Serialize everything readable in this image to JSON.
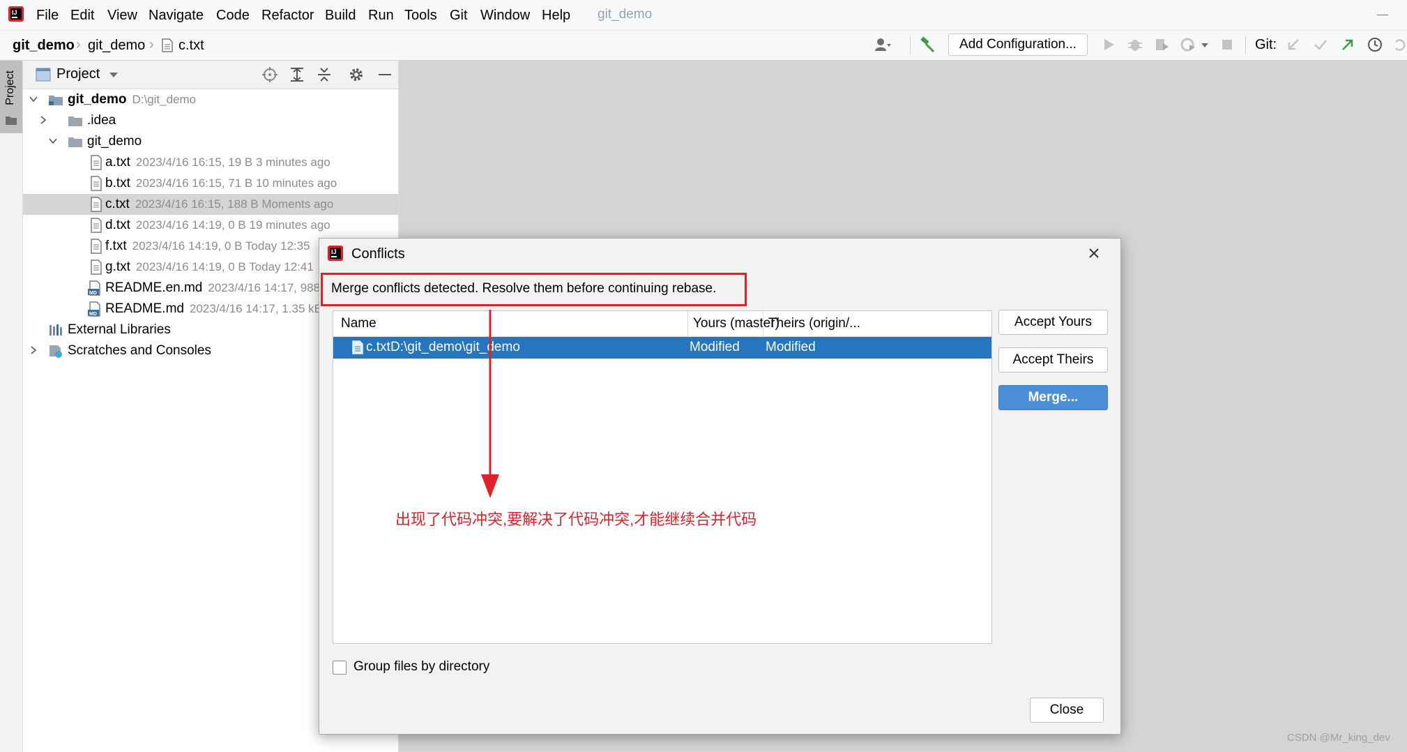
{
  "menu": {
    "items": [
      "File",
      "Edit",
      "View",
      "Navigate",
      "Code",
      "Refactor",
      "Build",
      "Run",
      "Tools",
      "Git",
      "Window",
      "Help"
    ],
    "window_title": "git_demo"
  },
  "breadcrumb": {
    "items": [
      "git_demo",
      "git_demo",
      "c.txt"
    ]
  },
  "toolbar": {
    "add_configuration": "Add Configuration...",
    "git_label": "Git:"
  },
  "stripe": {
    "project_label": "Project"
  },
  "project_panel": {
    "title": "Project",
    "tree": [
      {
        "name": "git_demo",
        "meta": "D:\\git_demo",
        "kind": "folder",
        "expanded": true,
        "bold": true
      },
      {
        "name": ".idea",
        "meta": "",
        "kind": "folder",
        "expanded": false
      },
      {
        "name": "git_demo",
        "meta": "",
        "kind": "folder",
        "expanded": true
      },
      {
        "name": "a.txt",
        "meta": "2023/4/16 16:15, 19 B 3 minutes ago",
        "kind": "file"
      },
      {
        "name": "b.txt",
        "meta": "2023/4/16 16:15, 71 B 10 minutes ago",
        "kind": "file"
      },
      {
        "name": "c.txt",
        "meta": "2023/4/16 16:15, 188 B Moments ago",
        "kind": "file",
        "selected": true
      },
      {
        "name": "d.txt",
        "meta": "2023/4/16 14:19, 0 B 19 minutes ago",
        "kind": "file"
      },
      {
        "name": "f.txt",
        "meta": "2023/4/16 14:19, 0 B Today 12:35",
        "kind": "file"
      },
      {
        "name": "g.txt",
        "meta": "2023/4/16 14:19, 0 B Today 12:41",
        "kind": "file"
      },
      {
        "name": "README.en.md",
        "meta": "2023/4/16 14:17, 988",
        "kind": "md"
      },
      {
        "name": "README.md",
        "meta": "2023/4/16 14:17, 1.35 kB",
        "kind": "md"
      },
      {
        "name": "External Libraries",
        "meta": "",
        "kind": "libs"
      },
      {
        "name": "Scratches and Consoles",
        "meta": "",
        "kind": "scratches",
        "expanded": false
      }
    ]
  },
  "dialog": {
    "title": "Conflicts",
    "message": "Merge conflicts detected. Resolve them before continuing rebase.",
    "columns": [
      "Name",
      "Yours (master)",
      "Theirs (origin/..."
    ],
    "rows": [
      {
        "name": "c.txt",
        "path": "D:\\git_demo\\git_demo",
        "yours": "Modified",
        "theirs": "Modified"
      }
    ],
    "accept_yours": "Accept Yours",
    "accept_theirs": "Accept Theirs",
    "merge": "Merge...",
    "group_by_directory": "Group files by directory",
    "close": "Close"
  },
  "annotation": {
    "text": "出现了代码冲突,要解决了代码冲突,才能继续合并代码",
    "color": "#e0202a"
  },
  "watermark": "CSDN @Mr_king_dev",
  "colors": {
    "selection": "#2675bf",
    "merge_button": "#4a8fd8",
    "annotation": "#e0202a"
  }
}
